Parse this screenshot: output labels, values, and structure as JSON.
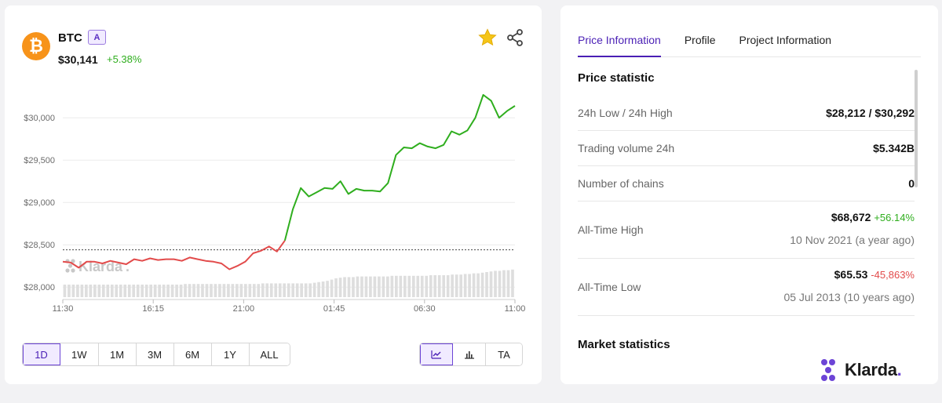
{
  "coin": {
    "symbol": "BTC",
    "grade": "A",
    "price": "$30,141",
    "change": "+5.38%",
    "logo_glyph": "₿",
    "logo_color": "#f7931a"
  },
  "icons": {
    "favorite": "star-icon",
    "share": "share-icon"
  },
  "colors": {
    "up": "#2fae1e",
    "down": "#e24b4b",
    "accent": "#4a1fb5"
  },
  "range_buttons": [
    "1D",
    "1W",
    "1M",
    "3M",
    "6M",
    "1Y",
    "ALL"
  ],
  "range_selected": "1D",
  "chart_type_buttons": [
    {
      "name": "line-chart-icon",
      "label": ""
    },
    {
      "name": "bar-chart-icon",
      "label": ""
    },
    {
      "name": "ta",
      "label": "TA"
    }
  ],
  "watermark": "Klarda",
  "chart_data": {
    "type": "line",
    "x_ticks": [
      "11:30",
      "16:15",
      "21:00",
      "01:45",
      "06:30",
      "11:00"
    ],
    "y_ticks": [
      "$28,000",
      "$28,500",
      "$29,000",
      "$29,500",
      "$30,000"
    ],
    "y_tick_values": [
      28000,
      28500,
      29000,
      29500,
      30000
    ],
    "ylim": [
      27900,
      30400
    ],
    "baseline": 28440,
    "grid": "horizontal",
    "series": [
      {
        "values": [
          28300,
          28290,
          28230,
          28300,
          28300,
          28280,
          28310,
          28290,
          28270,
          28330,
          28310,
          28340,
          28320,
          28330,
          28330,
          28310,
          28350,
          28330,
          28310,
          28300,
          28280,
          28210,
          28250,
          28300,
          28400,
          28430,
          28480,
          28420,
          28550,
          28920,
          29170,
          29070,
          29120,
          29170,
          29160,
          29250,
          29100,
          29160,
          29140,
          29140,
          29130,
          29230,
          29560,
          29650,
          29640,
          29700,
          29660,
          29640,
          29680,
          29840,
          29800,
          29850,
          30000,
          30270,
          30200,
          30000,
          30080,
          30141
        ]
      }
    ],
    "volume": [
      20,
      20,
      20,
      20,
      20,
      20,
      20,
      20,
      20,
      20,
      20,
      20,
      20,
      20,
      20,
      20,
      20,
      20,
      20,
      20,
      20,
      20,
      20,
      20,
      20,
      20,
      20,
      20,
      21,
      21,
      21,
      21,
      21,
      21,
      21,
      21,
      21,
      21,
      21,
      21,
      21,
      21,
      21,
      21,
      21,
      21,
      22,
      22,
      22,
      22,
      22,
      22,
      22,
      22,
      22,
      22,
      22,
      22,
      23,
      24,
      25,
      26,
      28,
      30,
      31,
      32,
      32,
      32,
      33,
      33,
      33,
      33,
      33,
      33,
      33,
      33,
      34,
      34,
      34,
      34,
      34,
      34,
      34,
      34,
      34,
      35,
      35,
      35,
      35,
      35,
      36,
      36,
      36,
      37,
      37,
      38,
      38,
      39,
      40,
      41,
      42,
      42,
      43,
      43,
      44
    ]
  },
  "info": {
    "tabs": [
      "Price Information",
      "Profile",
      "Project Information"
    ],
    "active_tab": "Price Information",
    "price_statistic_title": "Price statistic",
    "rows": [
      {
        "label": "24h Low / 24h High",
        "value": "$28,212 / $30,292"
      },
      {
        "label": "Trading volume 24h",
        "value": "$5.342B"
      },
      {
        "label": "Number of chains",
        "value": "0"
      }
    ],
    "ath": {
      "label": "All-Time High",
      "value": "$68,672",
      "change": "+56.14%",
      "date": "10 Nov 2021 (a year ago)"
    },
    "atl": {
      "label": "All-Time Low",
      "value": "$65.53",
      "change": "-45,863%",
      "date": "05 Jul 2013 (10 years ago)"
    },
    "market_statistics_title": "Market statistics",
    "brand": "Klarda"
  }
}
